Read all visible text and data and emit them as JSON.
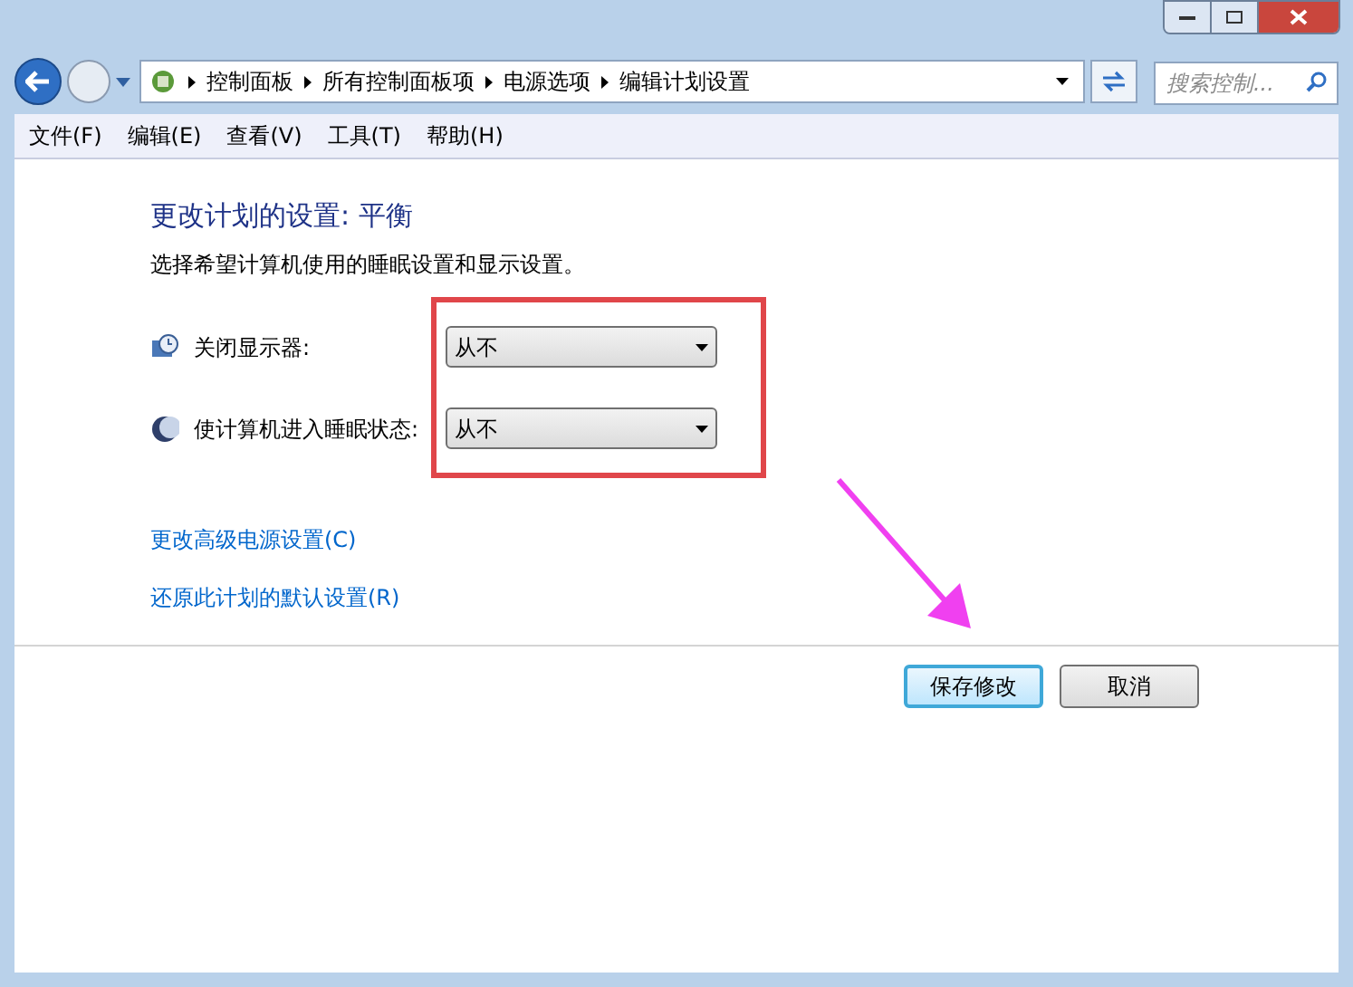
{
  "address_bar": {
    "breadcrumbs": [
      "控制面板",
      "所有控制面板项",
      "电源选项",
      "编辑计划设置"
    ]
  },
  "search": {
    "placeholder": "搜索控制..."
  },
  "menu": [
    "文件(F)",
    "编辑(E)",
    "查看(V)",
    "工具(T)",
    "帮助(H)"
  ],
  "heading": "更改计划的设置: 平衡",
  "description": "选择希望计算机使用的睡眠设置和显示设置。",
  "settings": [
    {
      "kind": "display",
      "label": "关闭显示器:",
      "value": "从不"
    },
    {
      "kind": "sleep",
      "label": "使计算机进入睡眠状态:",
      "value": "从不"
    }
  ],
  "links": [
    "更改高级电源设置(C)",
    "还原此计划的默认设置(R)"
  ],
  "buttons": [
    {
      "label": "保存修改",
      "selected": true
    },
    {
      "label": "取消",
      "selected": false
    }
  ]
}
